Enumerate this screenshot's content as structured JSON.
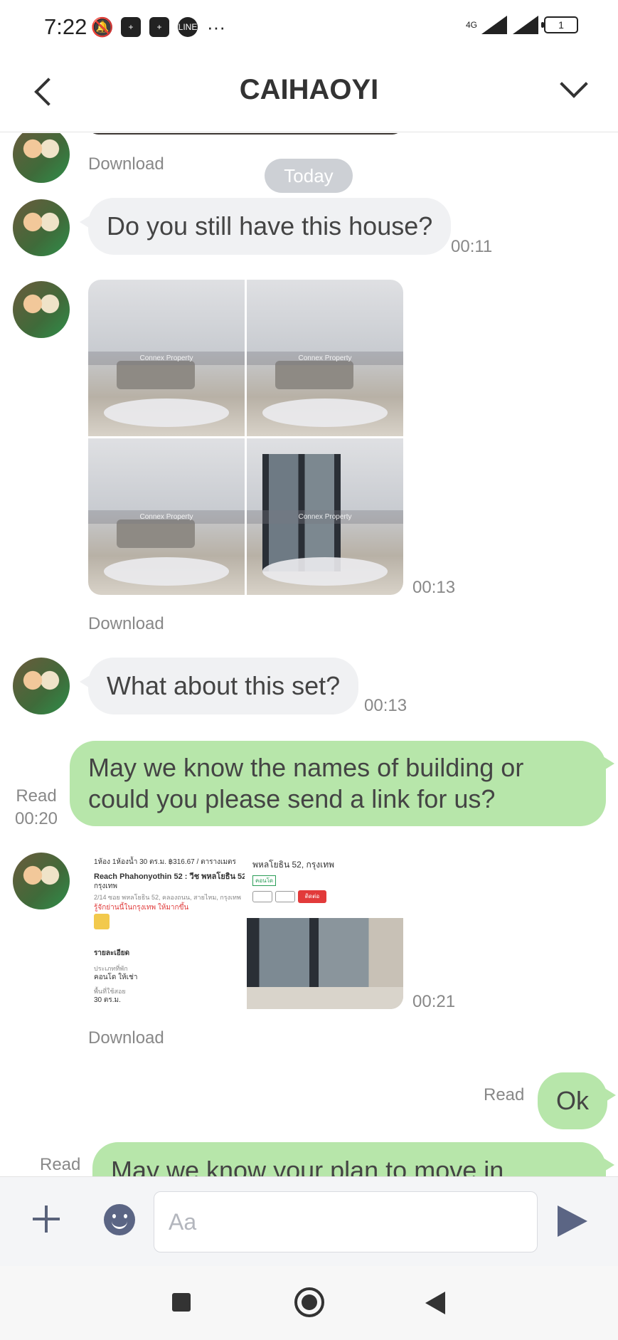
{
  "status_bar": {
    "time": "7:22",
    "network": "4G",
    "battery_level": "1",
    "more_label": "···"
  },
  "header": {
    "title": "CAIHAOYI"
  },
  "chat": {
    "date_chip": "Today",
    "messages": [
      {
        "text": "Download"
      },
      {
        "text": "Do you still have this house?",
        "time": "00:11"
      },
      {
        "time": "00:13",
        "download": "Download",
        "watermark": "Connex Property"
      },
      {
        "text": "What about this set?",
        "time": "00:13"
      },
      {
        "text": "May we know the names of building or could you please send a link for us?",
        "status": "Read",
        "time": "00:20"
      },
      {
        "time": "00:21",
        "download": "Download",
        "shot": {
          "line1": "1ห้อง  1ห้องน้ำ  30 ตร.ม.  ฿316.67 / ตารางเมตร",
          "line2": "Reach Phahonyothin 52 : วีช พหลโยธิน 52,",
          "line3": "กรุงเทพ",
          "line4": "2/14 ซอย พหลโยธิน 52, คลองถนน, สายไหม, กรุงเทพ",
          "line5": "รู้จักย่านนี้ในกรุงเทพ ให้มากขึ้น",
          "line6": "รายละเอียด",
          "line7": "ประเภทที่พัก",
          "line8": "คอนโด ให้เช่า",
          "line9": "พื้นที่ใช้สอย",
          "line10": "30 ตร.ม.",
          "right_title": "พหลโยธิน 52, กรุงเทพ",
          "right_tag": "คอนโด",
          "right_btn": "ติดต่อ"
        }
      },
      {
        "text": "Ok",
        "status": "Read"
      },
      {
        "text": "May we know your plan to move in please?",
        "status": "Read"
      }
    ]
  },
  "composer": {
    "placeholder": "Aa"
  }
}
